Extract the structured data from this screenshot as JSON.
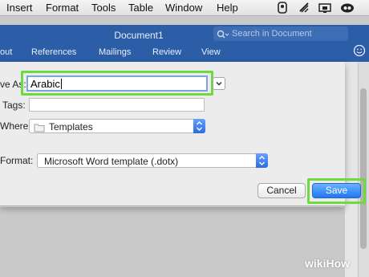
{
  "menubar": {
    "items": [
      {
        "label": "Insert"
      },
      {
        "label": "Format"
      },
      {
        "label": "Tools"
      },
      {
        "label": "Table"
      },
      {
        "label": "Window"
      },
      {
        "label": "Help"
      }
    ],
    "status_icons": [
      "evernote-icon",
      "wifi-icon",
      "display-icon",
      "creative-cloud-icon"
    ]
  },
  "window": {
    "title": "Document1",
    "search_placeholder": "Search in Document"
  },
  "ribbon": {
    "tabs": [
      {
        "label": "out"
      },
      {
        "label": "References"
      },
      {
        "label": "Mailings"
      },
      {
        "label": "Review"
      },
      {
        "label": "View"
      }
    ]
  },
  "dialog": {
    "save_as_label": "ve As:",
    "save_as_value": "Arabic",
    "tags_label": "Tags:",
    "where_label": "Where:",
    "where_value": "Templates",
    "format_label": "Format:",
    "format_value": "Microsoft Word template (.dotx)",
    "cancel_label": "Cancel",
    "save_label": "Save"
  },
  "watermark": {
    "text": "wikiHow"
  },
  "colors": {
    "ribbon_blue": "#2c5ea7",
    "highlight_green": "#6ddb3e",
    "primary_button": "#1f78f0"
  }
}
